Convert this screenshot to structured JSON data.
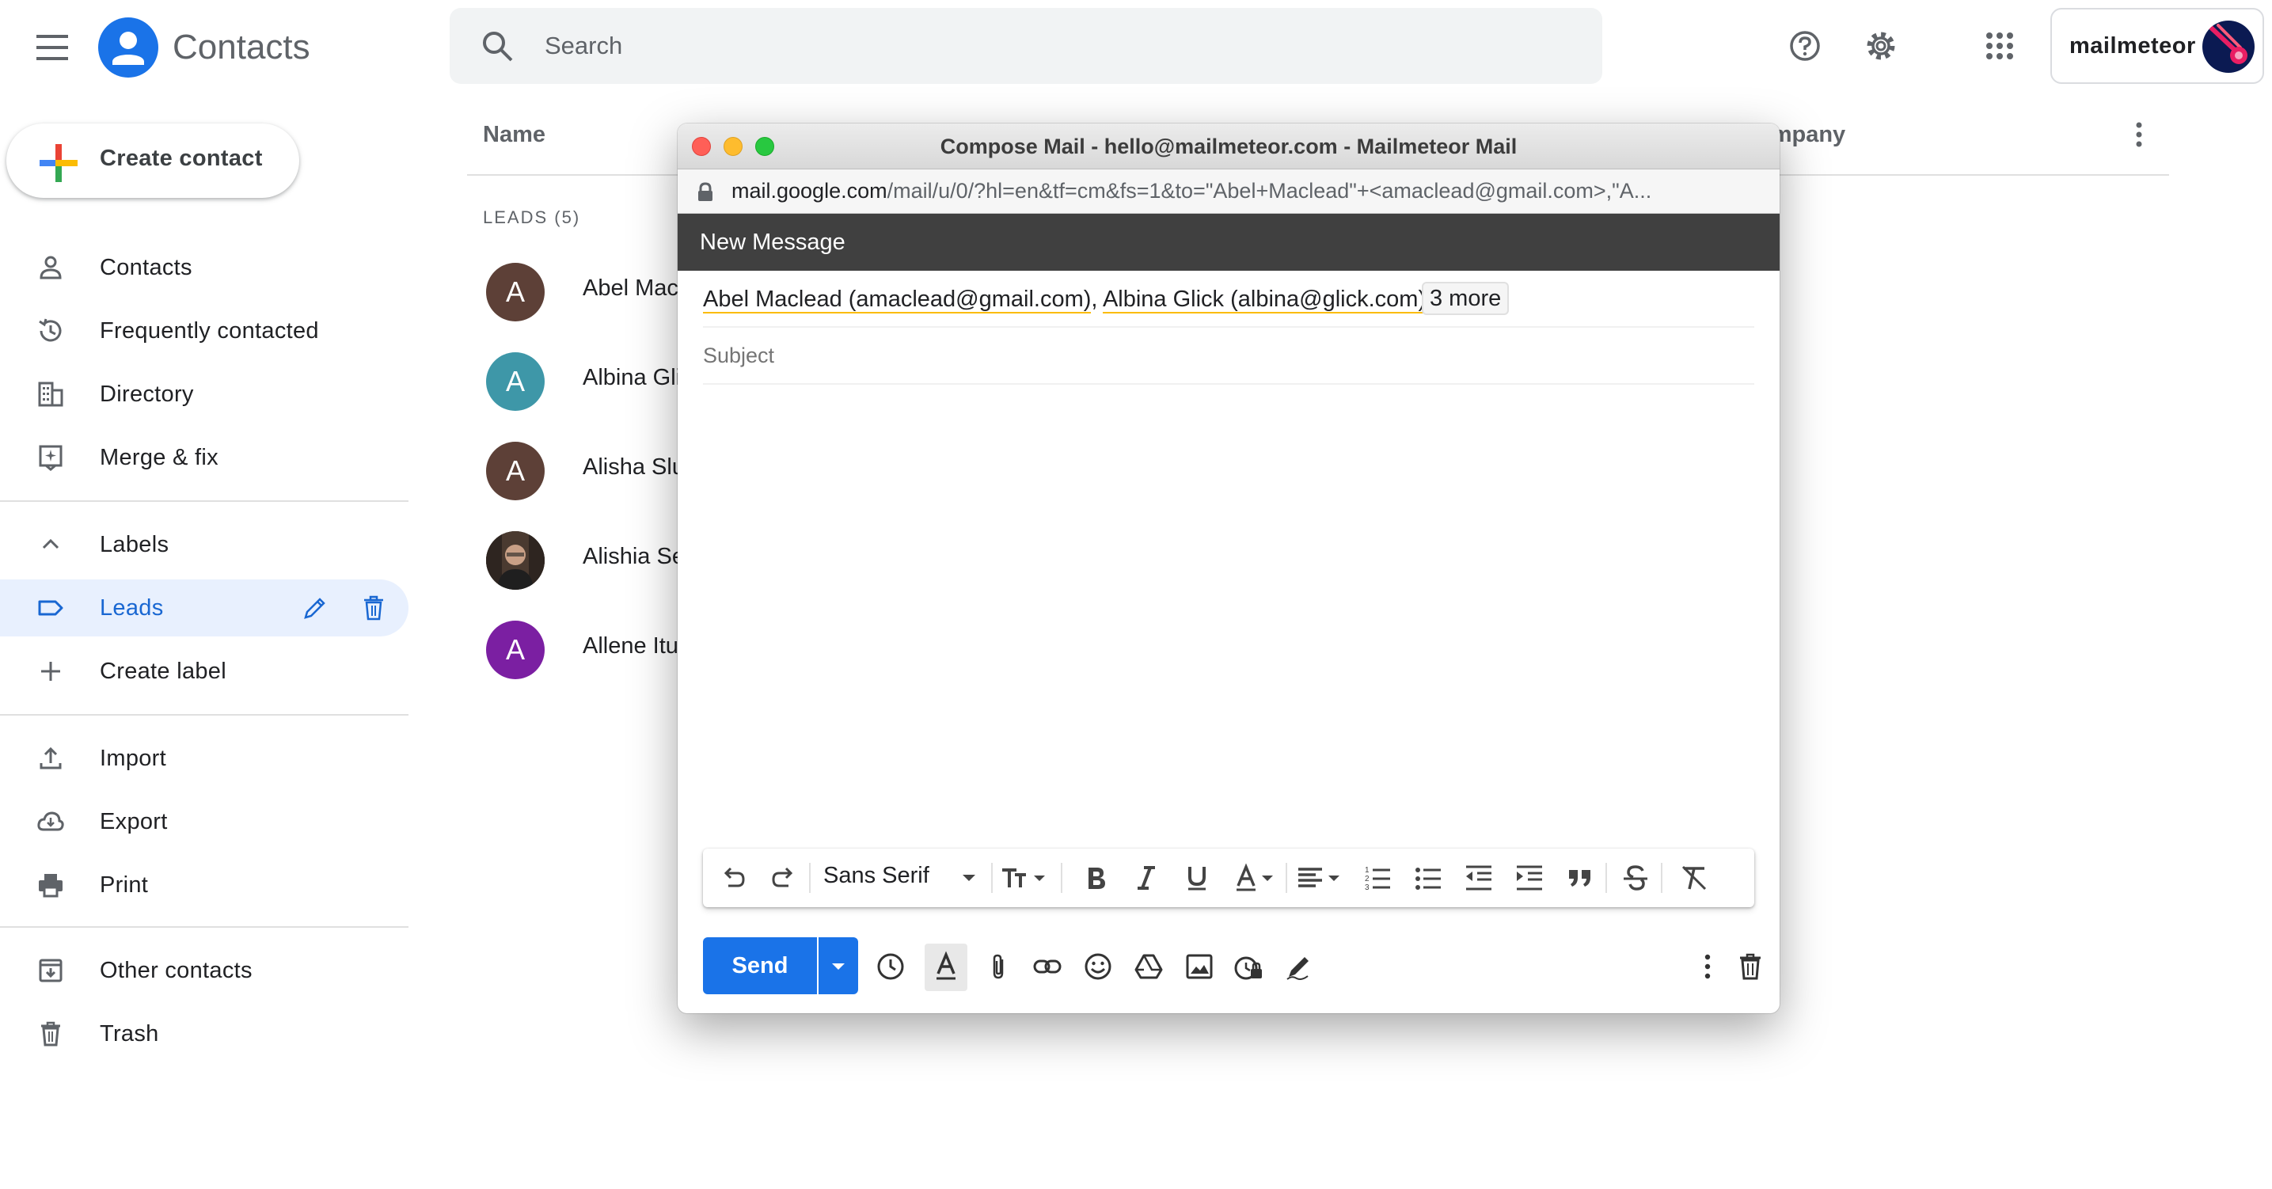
{
  "header": {
    "app_title": "Contacts",
    "search_placeholder": "Search",
    "brand": "mailmeteor"
  },
  "sidebar": {
    "create_label": "Create contact",
    "nav": [
      {
        "label": "Contacts",
        "icon": "person-icon"
      },
      {
        "label": "Frequently contacted",
        "icon": "history-icon"
      },
      {
        "label": "Directory",
        "icon": "building-icon"
      },
      {
        "label": "Merge & fix",
        "icon": "merge-icon"
      }
    ],
    "labels_heading": "Labels",
    "labels": [
      {
        "label": "Leads",
        "icon": "label-icon",
        "active": true
      }
    ],
    "create_label_text": "Create label",
    "actions": [
      {
        "label": "Import",
        "icon": "upload-icon"
      },
      {
        "label": "Export",
        "icon": "cloud-download-icon"
      },
      {
        "label": "Print",
        "icon": "print-icon"
      }
    ],
    "other": [
      {
        "label": "Other contacts",
        "icon": "archive-icon"
      },
      {
        "label": "Trash",
        "icon": "trash-icon"
      }
    ]
  },
  "list": {
    "columns": {
      "name": "Name",
      "company": "ompany"
    },
    "group_header": "LEADS (5)",
    "rows": [
      {
        "initial": "A",
        "name": "Abel Mac",
        "color": "#5d4037"
      },
      {
        "initial": "A",
        "name": "Albina Gli",
        "color": "#3e97a8"
      },
      {
        "initial": "A",
        "name": "Alisha Slu",
        "color": "#5d4037"
      },
      {
        "initial": "",
        "name": "Alishia Se",
        "color": "#3a3a3a",
        "photo": true
      },
      {
        "initial": "A",
        "name": "Allene Itu",
        "color": "#7b1fa2"
      }
    ]
  },
  "compose": {
    "window_title": "Compose Mail - hello@mailmeteor.com - Mailmeteor Mail",
    "url_host": "mail.google.com",
    "url_path": "/mail/u/0/?hl=en&tf=cm&fs=1&to=\"Abel+Maclead\"+<amaclead@gmail.com>,\"A...",
    "header_title": "New Message",
    "recipient_1": "Abel Maclead (amaclead@gmail.com)",
    "recipient_sep": ", ",
    "recipient_2": "Albina Glick (albina@glick.com)",
    "more_recipients": "3 more",
    "subject_placeholder": "Subject",
    "font_name": "Sans Serif",
    "send_label": "Send"
  },
  "colors": {
    "accent": "#1a73e8",
    "active_bg": "#e8f0fe",
    "active_text": "#1967d2",
    "compose_header": "#404040"
  }
}
